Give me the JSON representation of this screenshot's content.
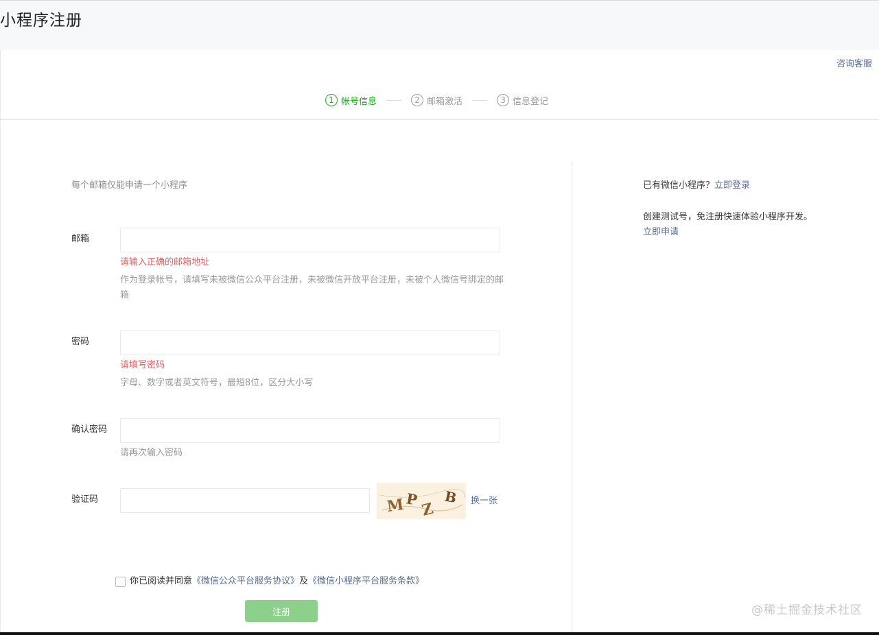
{
  "page": {
    "title": "小程序注册"
  },
  "header": {
    "consult_label": "咨询客服"
  },
  "steps": [
    {
      "num": "1",
      "label": "帐号信息",
      "active": true
    },
    {
      "num": "2",
      "label": "邮箱激活",
      "active": false
    },
    {
      "num": "3",
      "label": "信息登记",
      "active": false
    }
  ],
  "form": {
    "intro": "每个邮箱仅能申请一个小程序",
    "email": {
      "label": "邮箱",
      "value": "",
      "error": "请输入正确的邮箱地址",
      "tip": "作为登录帐号，请填写未被微信公众平台注册，未被微信开放平台注册，未被个人微信号绑定的邮箱"
    },
    "password": {
      "label": "密码",
      "value": "",
      "error": "请填写密码",
      "tip": "字母、数字或者英文符号，最短8位，区分大小写"
    },
    "confirm_password": {
      "label": "确认密码",
      "value": "",
      "tip": "请再次输入密码"
    },
    "captcha": {
      "label": "验证码",
      "value": "",
      "image_text": "MPZB",
      "refresh_label": "换一张"
    },
    "agreement": {
      "checked": false,
      "prefix": "你已阅读并同意",
      "link1": "《微信公众平台服务协议》",
      "connector": "及",
      "link2": "《微信小程序平台服务条款》"
    },
    "submit_label": "注册"
  },
  "sidebar": {
    "login_prefix": "已有微信小程序？",
    "login_link": "立即登录",
    "test_prefix": "创建测试号，免注册快速体验小程序开发。",
    "test_link": "立即申请"
  },
  "watermark": "@稀土掘金技术社区",
  "colors": {
    "accent_green": "#1aad19",
    "link_blue": "#576b95",
    "error_red": "#e15f63",
    "disabled_button": "#8dd08c"
  }
}
